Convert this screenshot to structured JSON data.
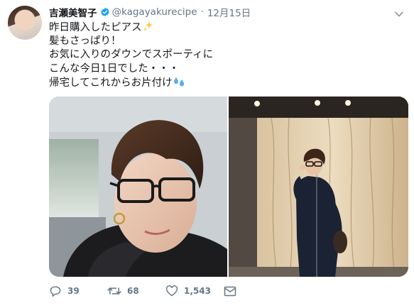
{
  "tweet": {
    "author_name": "吉瀬美智子",
    "handle": "@kagayakurecipe",
    "separator": "·",
    "date": "12月15日",
    "lines": [
      "昨日購入したピアス",
      "髪もさっぱり！",
      "お気に入りのダウンでスポーティに",
      "こんな今日1日でした・・・",
      "帰宅してこれからお片付け"
    ],
    "emojis": [
      "sparkles-emoji",
      "sweat-droplets-emoji"
    ],
    "images": [
      "selfie-photo",
      "elevator-full-body-photo"
    ],
    "actions": {
      "replies": "39",
      "retweets": "68",
      "likes": "1,543"
    }
  },
  "colors": {
    "text": "#14171a",
    "secondary": "#657786",
    "verified": "#1da1f2",
    "background": "#ffffff"
  }
}
